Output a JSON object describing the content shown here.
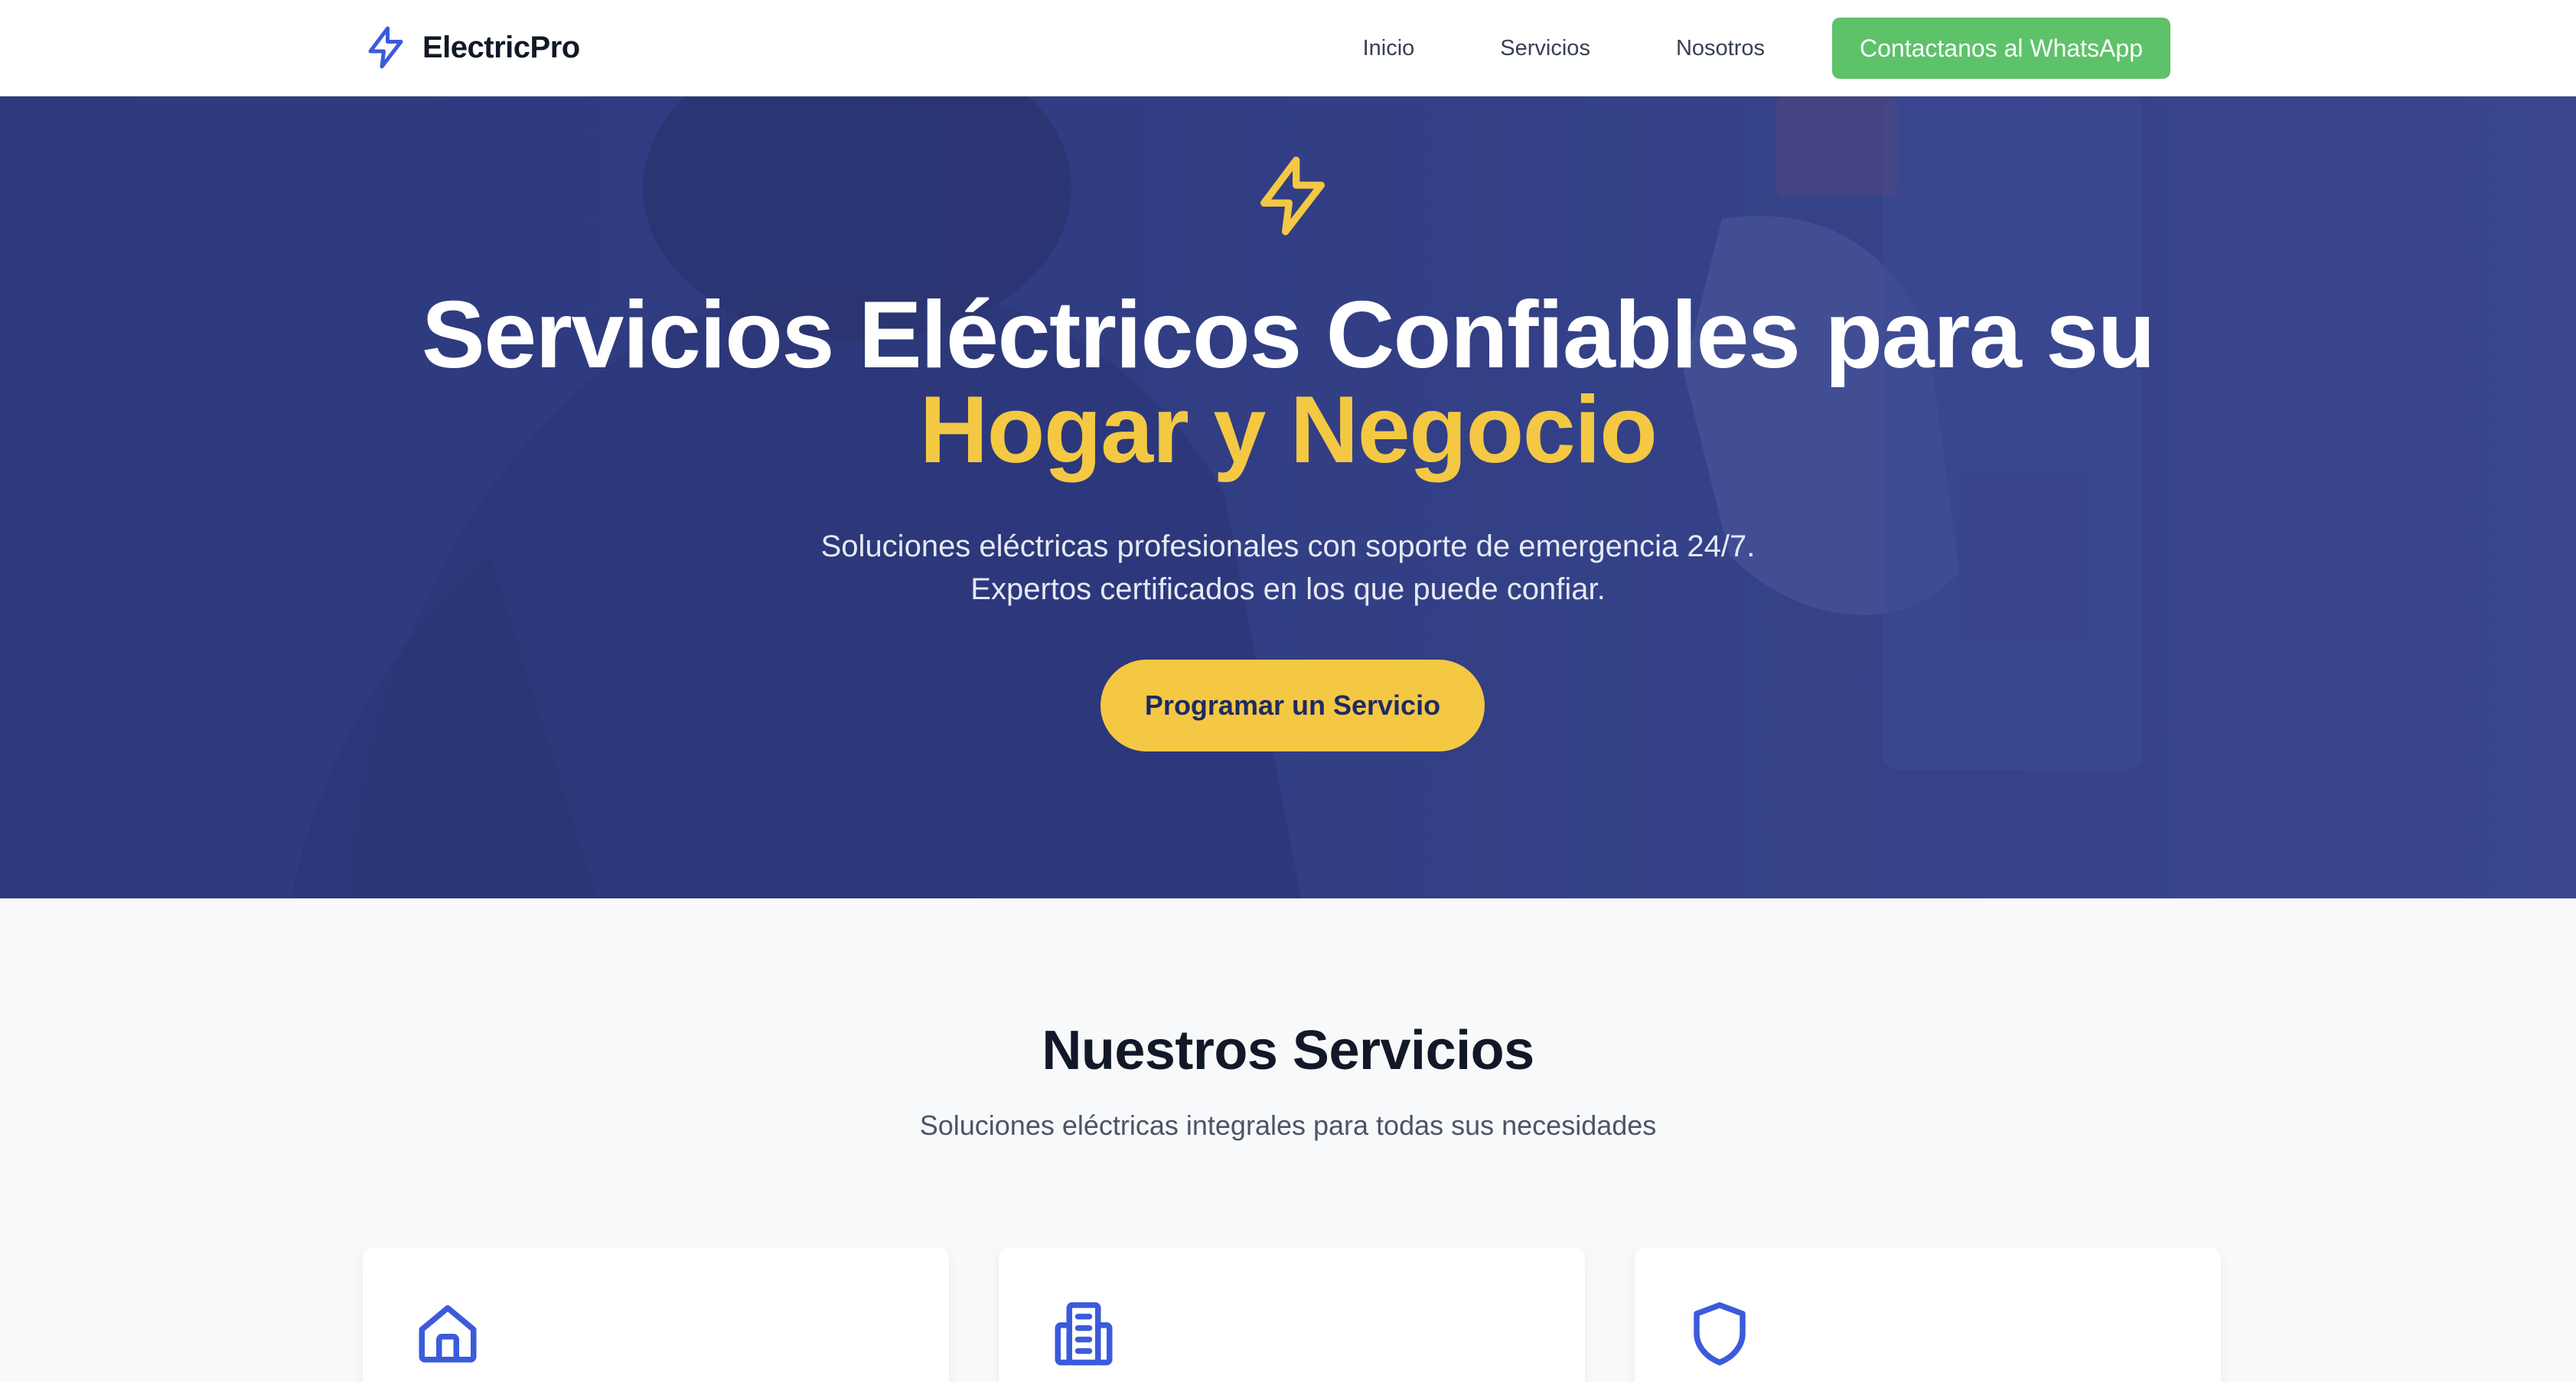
{
  "navbar": {
    "brand": "ElectricPro",
    "links": [
      "Inicio",
      "Servicios",
      "Nosotros"
    ],
    "cta": "Contactanos al WhatsApp"
  },
  "hero": {
    "title_line1": "Servicios Eléctricos Confiables para su",
    "title_line2": "Hogar y Negocio",
    "subtitle_line1": "Soluciones eléctricas profesionales con soporte de emergencia 24/7.",
    "subtitle_line2": "Expertos certificados en los que puede confiar.",
    "cta": "Programar un Servicio"
  },
  "services": {
    "title": "Nuestros Servicios",
    "subtitle": "Soluciones eléctricas integrales para todas sus necesidades",
    "cards": [
      {
        "icon": "home-icon"
      },
      {
        "icon": "building-icon"
      },
      {
        "icon": "shield-icon"
      }
    ]
  },
  "colors": {
    "brand_blue": "#3b5bdb",
    "accent_yellow": "#f4c843",
    "whatsapp_green": "#5ec26a",
    "hero_blue": "#323f84"
  }
}
